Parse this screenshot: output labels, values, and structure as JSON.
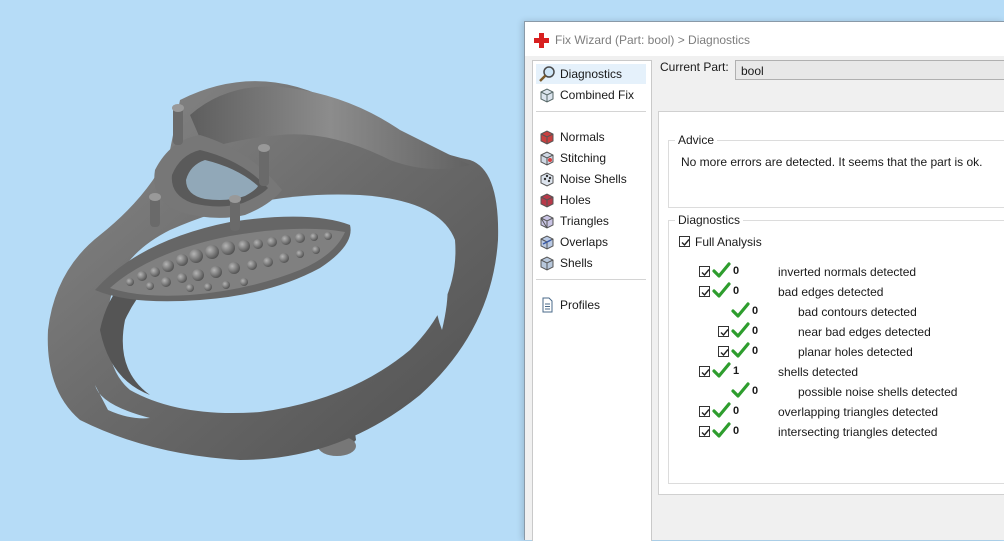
{
  "window": {
    "title": "Fix Wizard (Part: bool) > Diagnostics"
  },
  "nav": {
    "items": [
      {
        "label": "Diagnostics",
        "icon": "magnifier-icon",
        "selected": true
      },
      {
        "label": "Combined Fix",
        "icon": "cube-stack-icon"
      },
      {
        "label": "Normals",
        "icon": "normals-cube-icon"
      },
      {
        "label": "Stitching",
        "icon": "stitching-cube-icon"
      },
      {
        "label": "Noise Shells",
        "icon": "noise-shells-icon"
      },
      {
        "label": "Holes",
        "icon": "holes-cube-icon"
      },
      {
        "label": "Triangles",
        "icon": "triangles-cube-icon"
      },
      {
        "label": "Overlaps",
        "icon": "overlaps-cube-icon"
      },
      {
        "label": "Shells",
        "icon": "shells-cube-icon"
      },
      {
        "label": "Profiles",
        "icon": "document-icon"
      }
    ]
  },
  "current_part": {
    "label": "Current Part:",
    "value": "bool"
  },
  "advice": {
    "title": "Advice",
    "text": "No more errors are detected. It seems that the part is ok."
  },
  "diagnostics": {
    "title": "Diagnostics",
    "full_analysis_label": "Full Analysis",
    "full_analysis_checked": true,
    "rows": [
      {
        "checkbox": true,
        "count": "0",
        "label": "inverted normals detected",
        "indent": 0
      },
      {
        "checkbox": true,
        "count": "0",
        "label": "bad edges detected",
        "indent": 0
      },
      {
        "checkbox": false,
        "count": "0",
        "label": "bad contours detected",
        "indent": 1
      },
      {
        "checkbox": true,
        "count": "0",
        "label": "near bad edges detected",
        "indent": 1
      },
      {
        "checkbox": true,
        "count": "0",
        "label": "planar holes detected",
        "indent": 1
      },
      {
        "checkbox": true,
        "count": "1",
        "label": "shells detected",
        "indent": 0
      },
      {
        "checkbox": false,
        "count": "0",
        "label": "possible noise shells detected",
        "indent": 1
      },
      {
        "checkbox": true,
        "count": "0",
        "label": "overlapping triangles detected",
        "indent": 0
      },
      {
        "checkbox": true,
        "count": "0",
        "label": "intersecting triangles detected",
        "indent": 0
      }
    ]
  },
  "colors": {
    "viewport_bg": "#b6dcf7",
    "model": "#6f6f6f",
    "tick_green": "#2e9d2e",
    "title_icon_red": "#d82020",
    "selected_bg": "#e5f1fb"
  }
}
